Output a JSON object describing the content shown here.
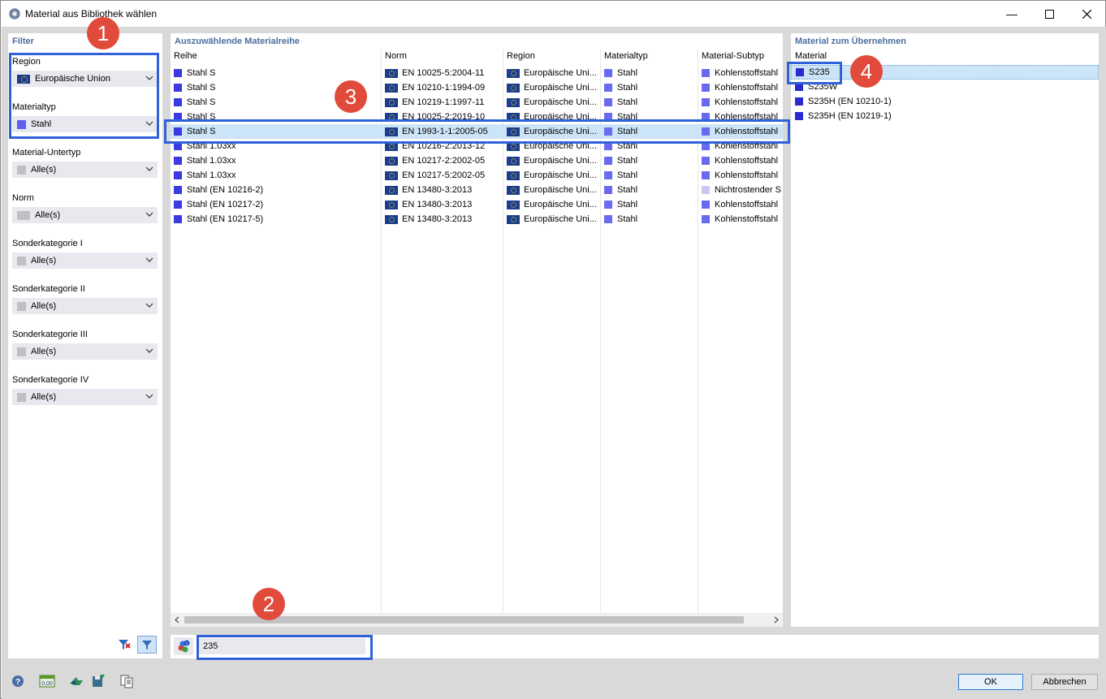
{
  "window": {
    "title": "Material aus Bibliothek wählen"
  },
  "filter": {
    "title": "Filter",
    "region_label": "Region",
    "region_value": "Europäische Union",
    "materialtyp_label": "Materialtyp",
    "materialtyp_value": "Stahl",
    "untertyp_label": "Material-Untertyp",
    "untertyp_value": "Alle(s)",
    "norm_label": "Norm",
    "norm_value": "Alle(s)",
    "sk1_label": "Sonderkategorie I",
    "sk1_value": "Alle(s)",
    "sk2_label": "Sonderkategorie II",
    "sk2_value": "Alle(s)",
    "sk3_label": "Sonderkategorie III",
    "sk3_value": "Alle(s)",
    "sk4_label": "Sonderkategorie IV",
    "sk4_value": "Alle(s)"
  },
  "series": {
    "title": "Auszuwählende Materialreihe",
    "columns": [
      "Reihe",
      "Norm",
      "Region",
      "Materialtyp",
      "Material-Subtyp"
    ],
    "rows": [
      [
        "Stahl S",
        "EN 10025-5:2004-11",
        "Europäische Uni...",
        "Stahl",
        "Kohlenstoffstahl"
      ],
      [
        "Stahl S",
        "EN 10210-1:1994-09",
        "Europäische Uni...",
        "Stahl",
        "Kohlenstoffstahl"
      ],
      [
        "Stahl S",
        "EN 10219-1:1997-11",
        "Europäische Uni...",
        "Stahl",
        "Kohlenstoffstahl"
      ],
      [
        "Stahl S",
        "EN 10025-2:2019-10",
        "Europäische Uni...",
        "Stahl",
        "Kohlenstoffstahl"
      ],
      [
        "Stahl S",
        "EN 1993-1-1:2005-05",
        "Europäische Uni...",
        "Stahl",
        "Kohlenstoffstahl"
      ],
      [
        "Stahl 1.03xx",
        "EN 10216-2:2013-12",
        "Europäische Uni...",
        "Stahl",
        "Kohlenstoffstahl"
      ],
      [
        "Stahl 1.03xx",
        "EN 10217-2:2002-05",
        "Europäische Uni...",
        "Stahl",
        "Kohlenstoffstahl"
      ],
      [
        "Stahl 1.03xx",
        "EN 10217-5:2002-05",
        "Europäische Uni...",
        "Stahl",
        "Kohlenstoffstahl"
      ],
      [
        "Stahl (EN 10216-2)",
        "EN 13480-3:2013",
        "Europäische Uni...",
        "Stahl",
        "Nichtrostender S"
      ],
      [
        "Stahl (EN 10217-2)",
        "EN 13480-3:2013",
        "Europäische Uni...",
        "Stahl",
        "Kohlenstoffstahl"
      ],
      [
        "Stahl (EN 10217-5)",
        "EN 13480-3:2013",
        "Europäische Uni...",
        "Stahl",
        "Kohlenstoffstahl"
      ]
    ],
    "selected_index": 4
  },
  "materials": {
    "title": "Material zum Übernehmen",
    "column": "Material",
    "items": [
      "S235",
      "S235W",
      "S235H (EN 10210-1)",
      "S235H (EN 10219-1)"
    ],
    "selected_index": 0
  },
  "search": {
    "value": "235"
  },
  "buttons": {
    "ok": "OK",
    "cancel": "Abbrechen"
  },
  "badges": [
    "1",
    "2",
    "3",
    "4"
  ],
  "colors": {
    "accent_highlight": "#2f62d9",
    "badge": "#e14b3b",
    "selection": "#cce4f7",
    "steel_swatch": "#4040e0",
    "stainless_swatch": "#c8c8f0",
    "panel_title": "#4a6fa0"
  }
}
